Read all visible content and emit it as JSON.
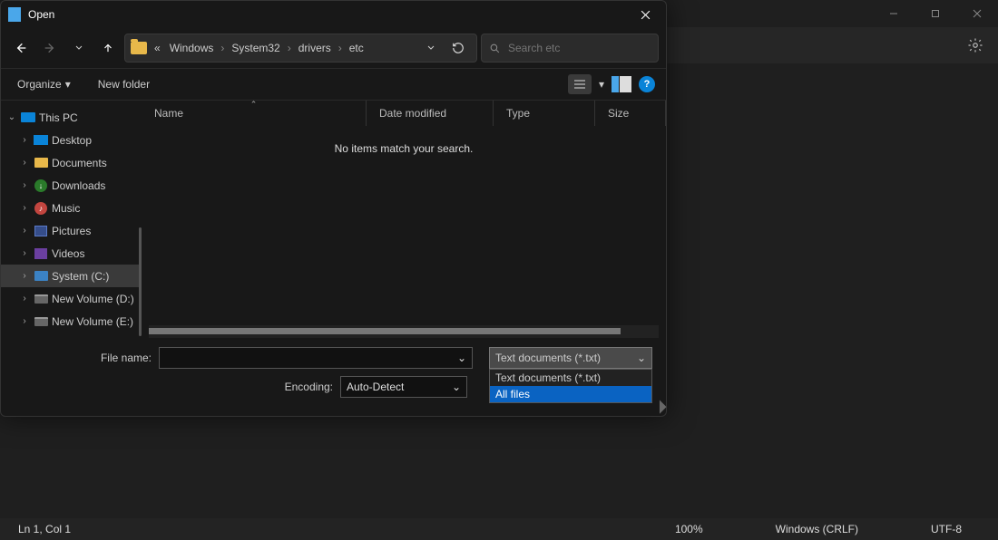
{
  "dialog": {
    "title": "Open",
    "breadcrumbs": {
      "prefix": "«",
      "parts": [
        "Windows",
        "System32",
        "drivers",
        "etc"
      ]
    },
    "search_placeholder": "Search etc",
    "cmdbar": {
      "organize": "Organize",
      "new_folder": "New folder"
    },
    "columns": {
      "name": "Name",
      "date": "Date modified",
      "type": "Type",
      "size": "Size"
    },
    "empty_msg": "No items match your search.",
    "filename_label": "File name:",
    "filename_value": "",
    "encoding_label": "Encoding:",
    "encoding_value": "Auto-Detect",
    "filetype_selected": "Text documents (*.txt)",
    "filetype_options": [
      "Text documents (*.txt)",
      "All files"
    ],
    "tree": [
      {
        "label": "This PC",
        "icon": "pc",
        "depth": 0,
        "expander": "⌄",
        "selected": false
      },
      {
        "label": "Desktop",
        "icon": "desktop",
        "depth": 1,
        "expander": "›",
        "selected": false
      },
      {
        "label": "Documents",
        "icon": "folder",
        "depth": 1,
        "expander": "›",
        "selected": false
      },
      {
        "label": "Downloads",
        "icon": "down",
        "depth": 1,
        "expander": "›",
        "selected": false
      },
      {
        "label": "Music",
        "icon": "music",
        "depth": 1,
        "expander": "›",
        "selected": false
      },
      {
        "label": "Pictures",
        "icon": "pic",
        "depth": 1,
        "expander": "›",
        "selected": false
      },
      {
        "label": "Videos",
        "icon": "vid",
        "depth": 1,
        "expander": "›",
        "selected": false
      },
      {
        "label": "System (C:)",
        "icon": "folderb",
        "depth": 1,
        "expander": "›",
        "selected": true
      },
      {
        "label": "New Volume (D:)",
        "icon": "drive",
        "depth": 1,
        "expander": "›",
        "selected": false
      },
      {
        "label": "New Volume (E:)",
        "icon": "drive",
        "depth": 1,
        "expander": "›",
        "selected": false
      }
    ]
  },
  "statusbar": {
    "pos": "Ln 1, Col 1",
    "zoom": "100%",
    "eol": "Windows (CRLF)",
    "enc": "UTF-8"
  }
}
